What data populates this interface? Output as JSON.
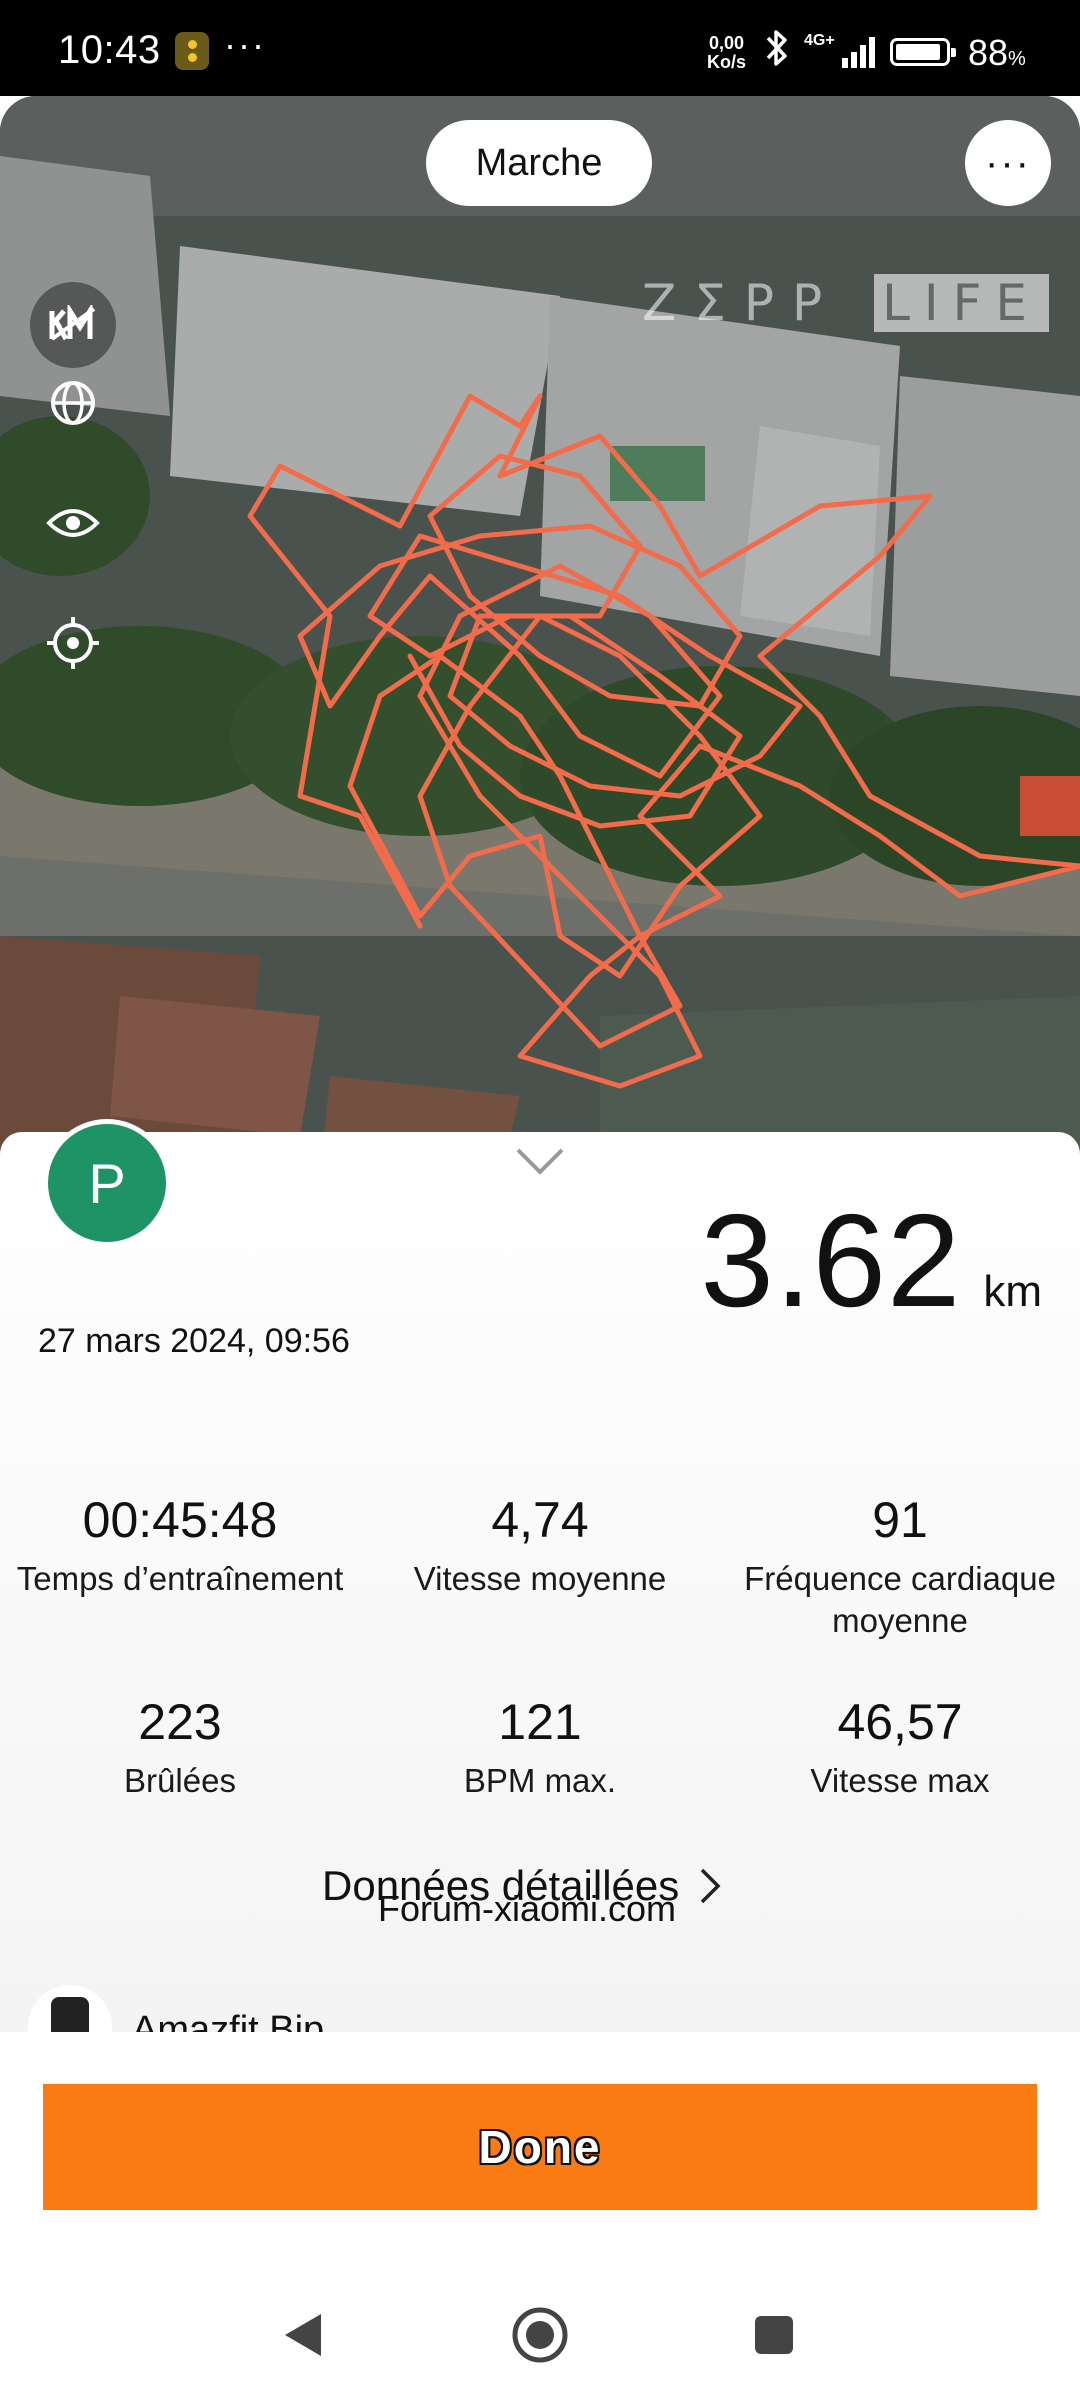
{
  "status_bar": {
    "time": "10:43",
    "more": "···",
    "net_speed_value": "0,00",
    "net_speed_unit": "Ko/s",
    "signal_label": "4G+",
    "battery_pct": "88",
    "battery_pct_sign": "%"
  },
  "map": {
    "activity_type": "Marche",
    "more_label": "···",
    "watermark_left": "ZΣPP",
    "watermark_right": "LIFE"
  },
  "summary": {
    "avatar_letter": "P",
    "distance_value": "3.62",
    "distance_unit": "km",
    "date": "27 mars 2024, 09:56"
  },
  "stats": [
    {
      "value": "00:45:48",
      "label": "Temps d’entraînement"
    },
    {
      "value": "4,74",
      "label": "Vitesse moyenne"
    },
    {
      "value": "91",
      "label": "Fréquence cardiaque moyenne"
    },
    {
      "value": "223",
      "label": "Brûlées"
    },
    {
      "value": "121",
      "label": "BPM max."
    },
    {
      "value": "46,57",
      "label": "Vitesse max"
    }
  ],
  "details_link": "Données détaillées",
  "overlay_watermark": "Forum-xiaomi.com",
  "device_name": "Amazfit Bip",
  "done_label": "Done",
  "colors": {
    "accent": "#fa7a14",
    "route": "#f26b4b",
    "avatar": "#1e9466"
  }
}
